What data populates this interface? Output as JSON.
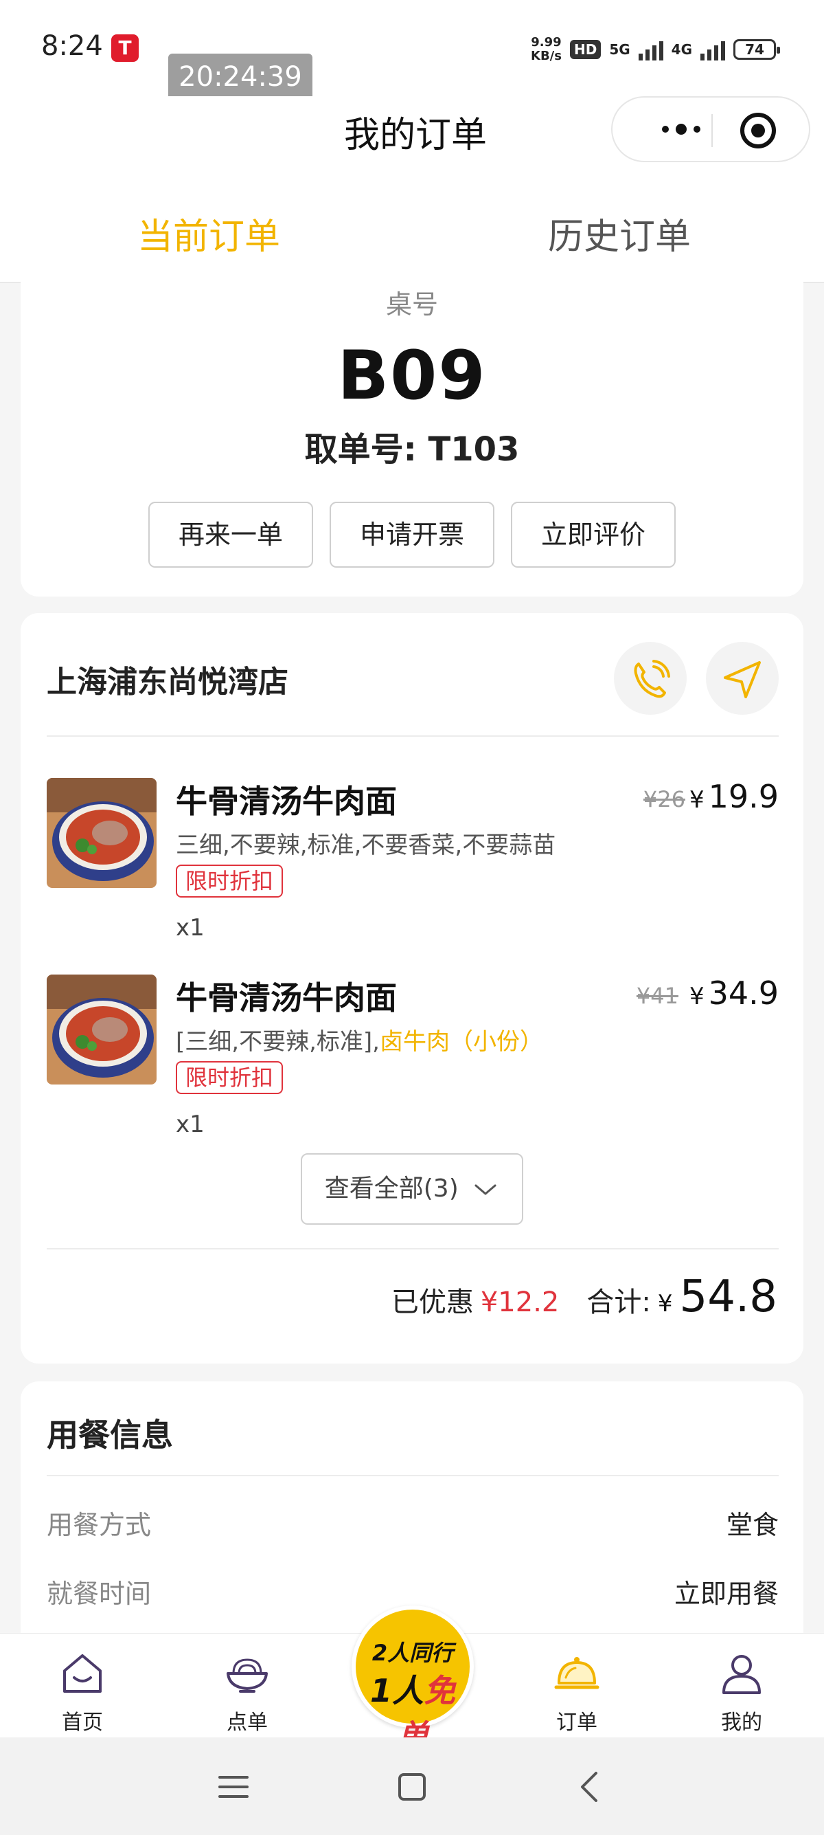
{
  "status_bar": {
    "time": "8:24",
    "clock_overlay": "20:24:39",
    "speed_value": "9.99",
    "speed_unit": "KB/s",
    "hd": "HD",
    "net1": "5G",
    "net2": "4G",
    "battery": "74"
  },
  "header": {
    "title": "我的订单"
  },
  "tabs": {
    "current": "当前订单",
    "history": "历史订单"
  },
  "order": {
    "table_label": "桌号",
    "table_number": "B09",
    "pickup": "取单号: T103",
    "actions": {
      "reorder": "再来一单",
      "invoice": "申请开票",
      "review": "立即评价"
    }
  },
  "store": {
    "name": "上海浦东尚悦湾店",
    "items": [
      {
        "name": "牛骨清汤牛肉面",
        "spec": "三细,不要辣,标准,不要香菜,不要蒜苗",
        "spec_extra": "",
        "tag": "限时折扣",
        "qty": "x1",
        "original_price": "¥26",
        "price_symbol": "¥",
        "price": "19.9"
      },
      {
        "name": "牛骨清汤牛肉面",
        "spec": "[三细,不要辣,标准],",
        "spec_extra": "卤牛肉（小份）",
        "tag": "限时折扣",
        "qty": "x1",
        "original_price": "¥41",
        "price_symbol": "¥",
        "price": "34.9"
      }
    ],
    "view_all": "查看全部(3)",
    "discount_label": "已优惠",
    "discount_value": "¥12.2",
    "total_label": "合计:",
    "total_symbol": "¥",
    "total_value": "54.8"
  },
  "dining_info": {
    "title": "用餐信息",
    "rows": [
      {
        "key": "用餐方式",
        "value": "堂食"
      },
      {
        "key": "就餐时间",
        "value": "立即用餐"
      }
    ]
  },
  "bottom_nav": {
    "home": "首页",
    "menu": "点单",
    "promo_line1": "2人同行",
    "promo_line2_a": "1人",
    "promo_line2_b": "免单",
    "orders": "订单",
    "mine": "我的"
  },
  "colors": {
    "accent": "#f2b400",
    "discount_red": "#e0333c"
  }
}
